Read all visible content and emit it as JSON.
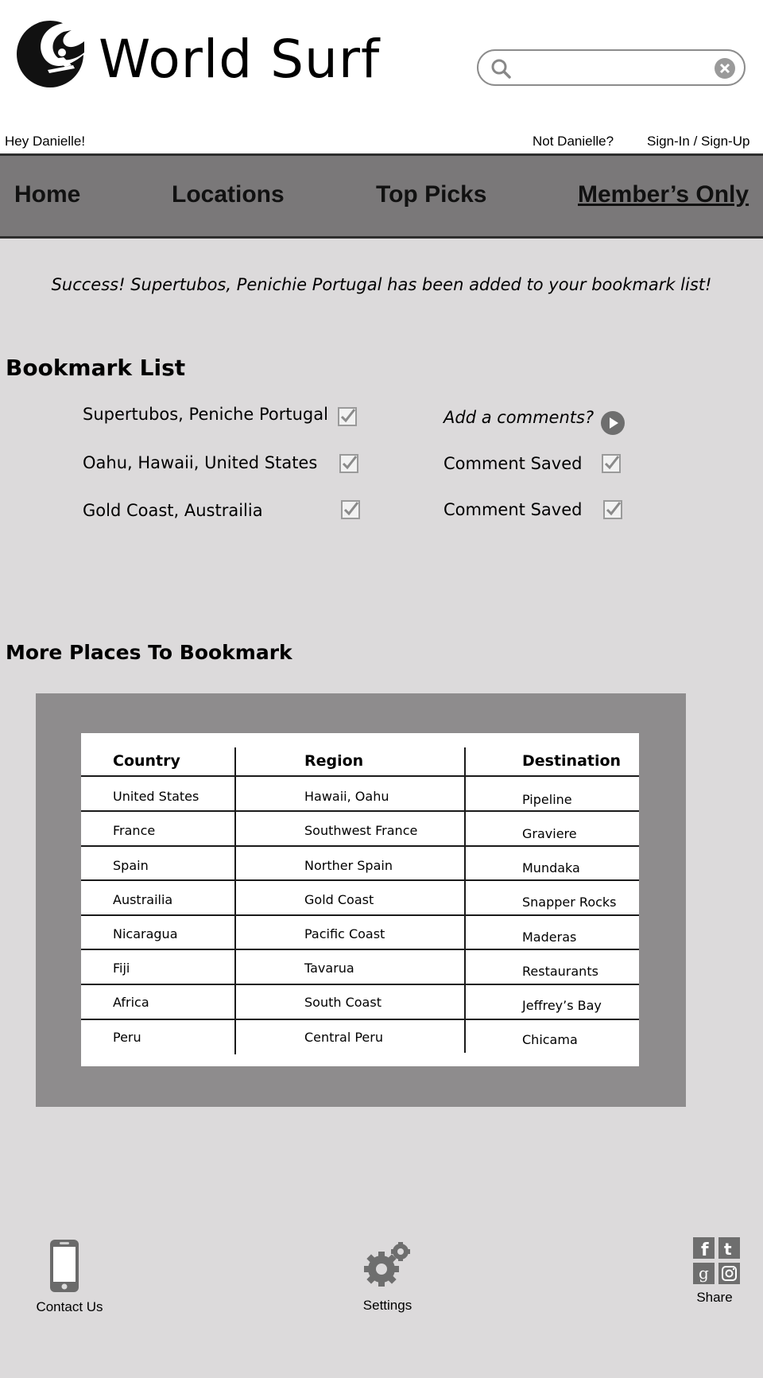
{
  "header": {
    "site_title": "World Surf",
    "search_placeholder": "",
    "greeting": "Hey Danielle!",
    "not_user": "Not Danielle?",
    "signin": "Sign-In / Sign-Up"
  },
  "nav": {
    "items": [
      {
        "label": "Home"
      },
      {
        "label": "Locations"
      },
      {
        "label": "Top Picks"
      },
      {
        "label": "Member’s Only"
      }
    ]
  },
  "main": {
    "success_message": "Success! Supertubos, Penichie Portugal has been added to your bookmark list!",
    "bookmark_title": "Bookmark List",
    "bookmarks": [
      {
        "place": "Supertubos, Peniche Portugal",
        "comment": "Add a comments?"
      },
      {
        "place": "Oahu, Hawaii, United States",
        "comment": "Comment Saved"
      },
      {
        "place": "Gold Coast, Austrailia",
        "comment": "Comment Saved"
      }
    ],
    "more_title": "More Places To Bookmark",
    "table": {
      "headers": [
        "Country",
        "Region",
        "Destination"
      ],
      "rows": [
        [
          "United States",
          "Hawaii, Oahu",
          "Pipeline"
        ],
        [
          "France",
          "Southwest France",
          "Graviere"
        ],
        [
          "Spain",
          "Norther Spain",
          "Mundaka"
        ],
        [
          "Austrailia",
          "Gold Coast",
          "Snapper Rocks"
        ],
        [
          "Nicaragua",
          "Pacific Coast",
          "Maderas"
        ],
        [
          "Fiji",
          "Tavarua",
          "Restaurants"
        ],
        [
          "Africa",
          "South Coast",
          "Jeffrey’s Bay"
        ],
        [
          "Peru",
          "Central Peru",
          "Chicama"
        ]
      ]
    }
  },
  "footer": {
    "contact": "Contact Us",
    "settings": "Settings",
    "share": "Share"
  },
  "colors": {
    "nav_bg": "#7a7879",
    "main_bg": "#dcdadb",
    "table_frame": "#8e8c8d"
  }
}
